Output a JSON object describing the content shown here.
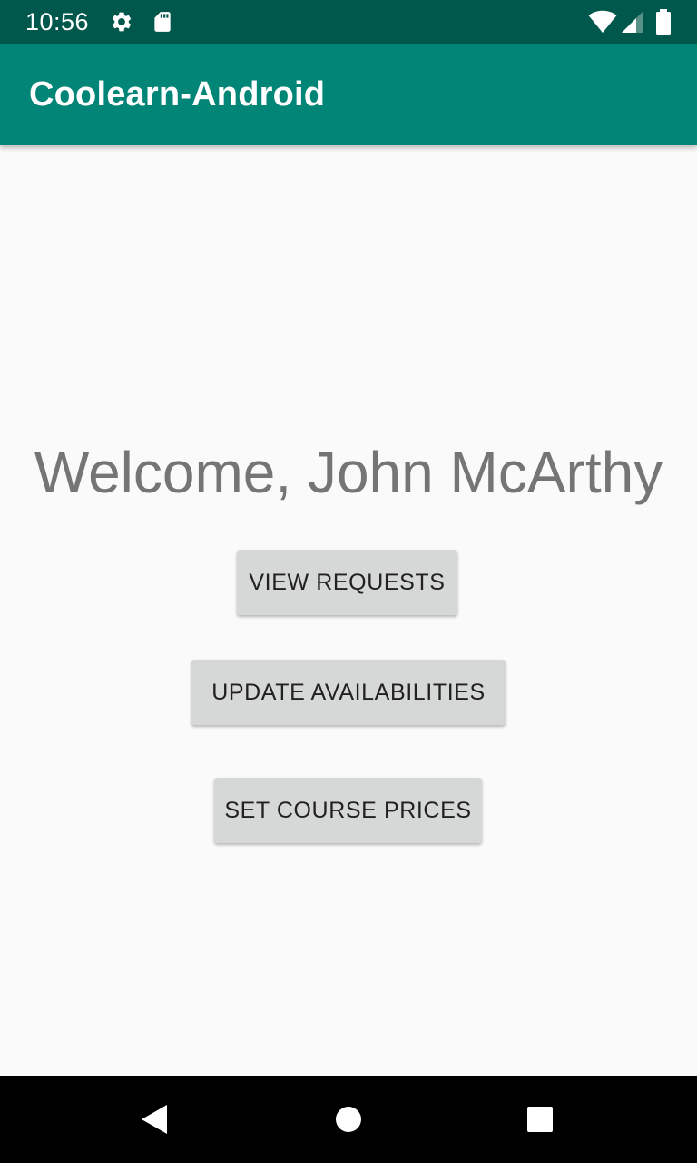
{
  "status_bar": {
    "time": "10:56",
    "icons": [
      "gear-icon",
      "sd-card-icon",
      "wifi-icon",
      "cell-signal-icon",
      "battery-icon"
    ]
  },
  "app_bar": {
    "title": "Coolearn-Android"
  },
  "main": {
    "welcome_text": "Welcome, John McArthy",
    "buttons": [
      {
        "label": "VIEW REQUESTS"
      },
      {
        "label": "UPDATE AVAILABILITIES"
      },
      {
        "label": "SET COURSE PRICES"
      }
    ]
  },
  "nav_bar": {
    "icons": [
      "back-icon",
      "home-icon",
      "recents-icon"
    ]
  },
  "colors": {
    "status_bar": "#00574b",
    "app_bar": "#008577",
    "background": "#fafafa",
    "button": "#d6d7d7",
    "welcome_text": "#757575"
  }
}
